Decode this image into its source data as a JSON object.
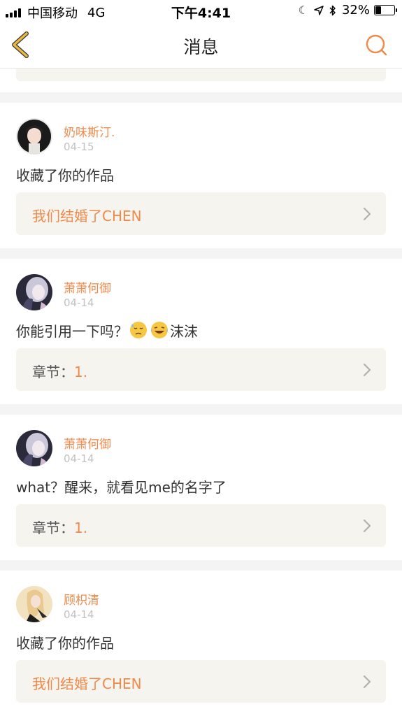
{
  "status_bar": {
    "carrier": "中国移动",
    "network": "4G",
    "time": "下午4:41",
    "battery": "32%",
    "battery_level": 0.32
  },
  "nav": {
    "title": "消息",
    "back_icon": "chevron-left-icon",
    "search_icon": "search-icon"
  },
  "messages": [
    {
      "username": "奶味斯汀.",
      "date": "04-15",
      "content": "收藏了你的作品",
      "link_prefix": "",
      "link_text": "我们结婚了CHEN"
    },
    {
      "username": "萧萧何御",
      "date": "04-14",
      "content_before": "你能引用一下吗？",
      "content_after": "沫沫",
      "emojis": [
        "sweat-emoji",
        "laughing-tears-emoji"
      ],
      "link_prefix": "章节：",
      "link_text": "1."
    },
    {
      "username": "萧萧何御",
      "date": "04-14",
      "content": "what？醒来，就看见me的名字了",
      "link_prefix": "章节：",
      "link_text": "1."
    },
    {
      "username": "顾枳清",
      "date": "04-14",
      "content": "收藏了你的作品",
      "link_prefix": "",
      "link_text": "我们结婚了CHEN"
    }
  ],
  "colors": {
    "accent": "#f08a4b",
    "back_icon": "#e8b93a",
    "link_bg": "#f6f4ee",
    "date": "#c2c2c2"
  }
}
